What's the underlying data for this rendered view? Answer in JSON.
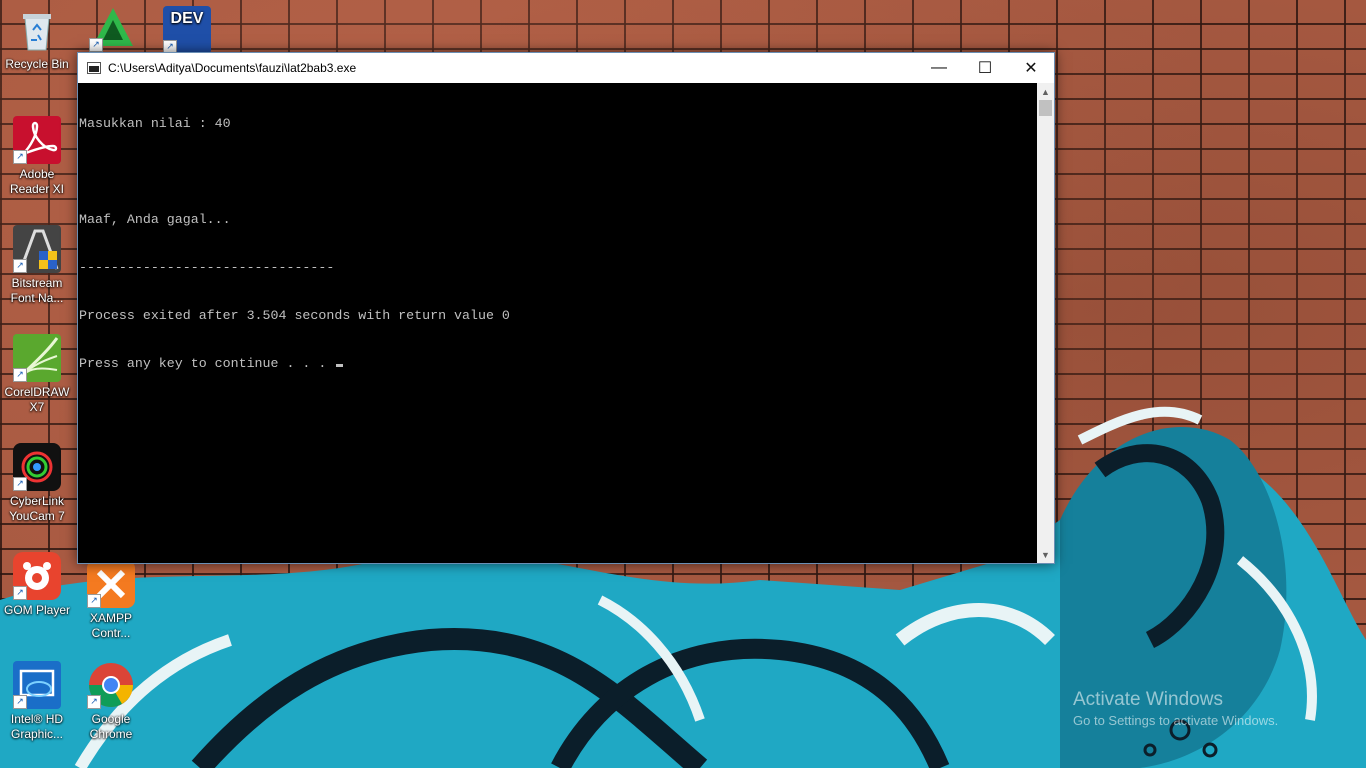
{
  "desktop": {
    "icons": [
      {
        "label": "Recycle Bin"
      },
      {
        "label": ""
      },
      {
        "label": "DEV"
      },
      {
        "label": "Adobe Reader XI"
      },
      {
        "label": "Bitstream Font Na..."
      },
      {
        "label": "CorelDRAW X7"
      },
      {
        "label": "CyberLink YouCam 7"
      },
      {
        "label": "GOM Player"
      },
      {
        "label": "XAMPP Contr..."
      },
      {
        "label": "Intel® HD Graphic..."
      },
      {
        "label": "Google Chrome"
      }
    ],
    "watermark": {
      "line1": "Activate Windows",
      "line2": "Go to Settings to activate Windows."
    }
  },
  "window": {
    "title": "C:\\Users\\Aditya\\Documents\\fauzi\\lat2bab3.exe",
    "buttons": {
      "minimize": "—",
      "maximize": "☐",
      "close": "✕"
    }
  },
  "console": {
    "lines": [
      "Masukkan nilai : 40",
      "",
      "Maaf, Anda gagal...",
      "--------------------------------",
      "Process exited after 3.504 seconds with return value 0",
      "Press any key to continue . . . "
    ]
  },
  "colors": {
    "console_bg": "#000000",
    "console_text": "#c0c0c0",
    "brick": "#a85a42",
    "graffiti_blue": "#1fa8c4"
  }
}
